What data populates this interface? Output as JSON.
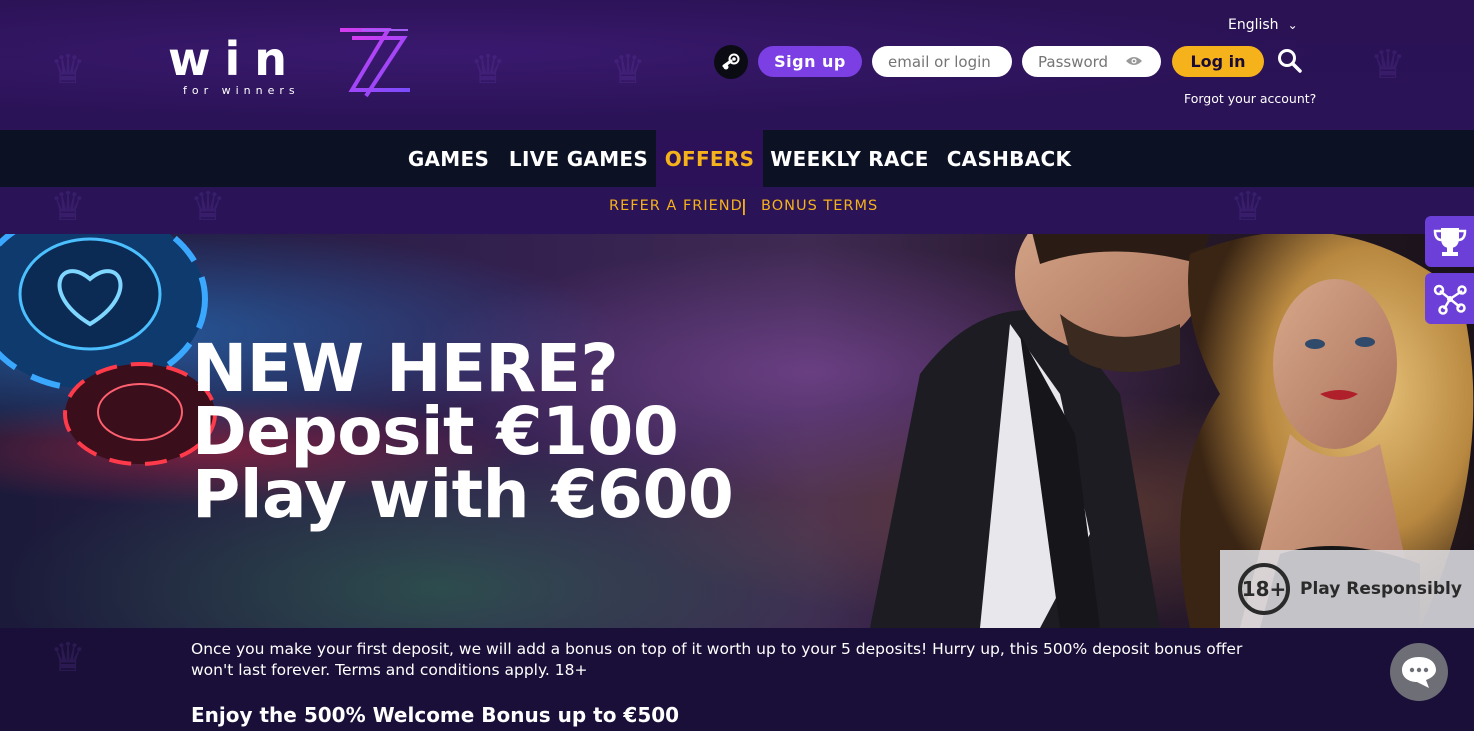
{
  "brand": {
    "logo_text": "win",
    "logo_tagline": "for winners"
  },
  "header": {
    "language": "English",
    "signup_label": "Sign up",
    "email_placeholder": "email or login",
    "password_placeholder": "Password",
    "login_label": "Log in",
    "forgot_label": "Forgot your account?"
  },
  "main_nav": {
    "items": [
      {
        "label": "GAMES",
        "active": false
      },
      {
        "label": "LIVE GAMES",
        "active": false
      },
      {
        "label": "OFFERS",
        "active": true
      },
      {
        "label": "WEEKLY RACE",
        "active": false
      },
      {
        "label": "CASHBACK",
        "active": false
      }
    ]
  },
  "sub_nav": {
    "items": [
      "REFER A FRIEND",
      "BONUS TERMS"
    ],
    "separator": "|"
  },
  "hero": {
    "line1": "NEW HERE?",
    "line2": "Deposit €100",
    "line3": "Play with €600"
  },
  "responsible": {
    "age_badge": "18+",
    "label": "Play Responsibly"
  },
  "content": {
    "promo_text": "Once you make your first deposit, we will add a bonus on top of it worth up to your 5 deposits! Hurry up, this 500% deposit bonus offer won't last forever. Terms and conditions apply. 18+",
    "heading": "Enjoy the 500% Welcome Bonus up to €500"
  },
  "colors": {
    "accent_purple": "#7b3fe4",
    "accent_yellow": "#f6b21b",
    "header_bg": "#2a1254",
    "nav_bg": "#0c1224"
  }
}
